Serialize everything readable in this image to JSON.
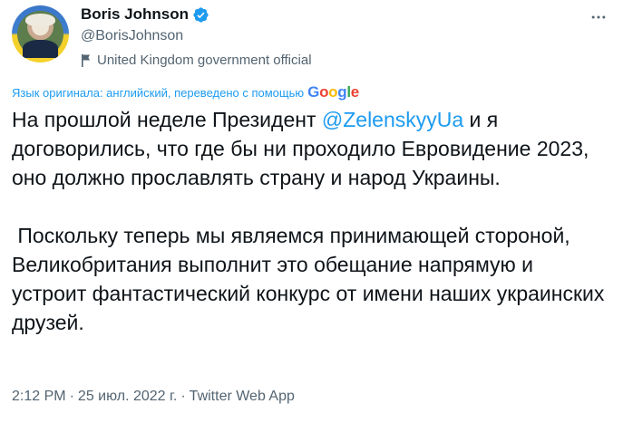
{
  "author": {
    "name": "Boris Johnson",
    "handle": "@BorisJohnson",
    "label": "United Kingdom government official",
    "verified_icon": "verified-badge",
    "flag_icon": "government-flag"
  },
  "translation": {
    "note": "Язык оригинала: английский, переведено с помощью",
    "provider": "Google"
  },
  "tweet": {
    "p1_before": "На прошлой неделе Президент ",
    "mention": "@ZelenskyyUa",
    "p1_after": " и я договорились, что где бы ни проходило Евровидение 2023, оно должно прославлять страну и народ Украины.",
    "p2": " Поскольку теперь мы являемся принимающей стороной, Великобритания выполнит это обещание напрямую и устроит фантастический конкурс от имени наших украинских друзей."
  },
  "meta": {
    "time": "2:12 PM",
    "separator1": "·",
    "date": "25 июл. 2022 г.",
    "separator2": "·",
    "source": "Twitter Web App"
  },
  "colors": {
    "accent": "#1d9bf0",
    "secondary_text": "#536471",
    "primary_text": "#0f1419"
  }
}
